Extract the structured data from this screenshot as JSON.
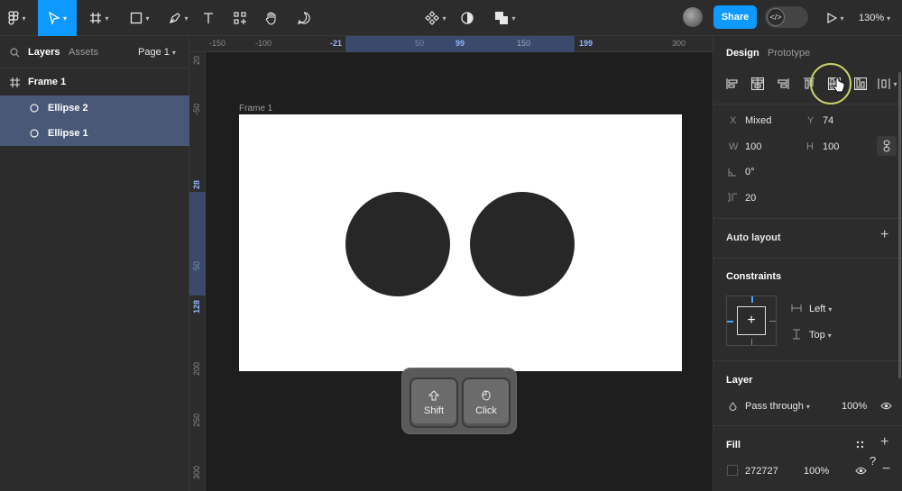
{
  "toolbar": {
    "share_label": "Share",
    "zoom_label": "130%",
    "devmode_icon": "</>",
    "accent_color": "#0d99ff"
  },
  "left_panel": {
    "tab_layers": "Layers",
    "tab_assets": "Assets",
    "page_label": "Page 1",
    "layers": [
      {
        "name": "Frame 1",
        "icon": "frame-icon"
      },
      {
        "name": "Ellipse 2",
        "icon": "ellipse-icon"
      },
      {
        "name": "Ellipse 1",
        "icon": "ellipse-icon"
      }
    ]
  },
  "ruler": {
    "top_ticks": [
      "-150",
      "-100",
      "-21",
      "50",
      "99",
      "150",
      "199",
      "300"
    ],
    "left_ticks": [
      "20",
      "-50",
      "28",
      "50",
      "128",
      "200",
      "250",
      "300"
    ]
  },
  "canvas": {
    "frame_label": "Frame 1",
    "frame_fill": "#ffffff",
    "ellipse_fill": "#272727",
    "keys": [
      {
        "label": "Shift",
        "icon": "shift-arrow-icon"
      },
      {
        "label": "Click",
        "icon": "mouse-icon"
      }
    ]
  },
  "right_panel": {
    "tab_design": "Design",
    "tab_prototype": "Prototype",
    "x_label": "X",
    "x_value": "Mixed",
    "y_label": "Y",
    "y_value": "74",
    "w_label": "W",
    "w_value": "100",
    "h_label": "H",
    "h_value": "100",
    "rotation_value": "0°",
    "corner_value": "20",
    "auto_layout_label": "Auto layout",
    "constraints_label": "Constraints",
    "constraint_h": "Left",
    "constraint_v": "Top",
    "layer_label": "Layer",
    "blend_mode": "Pass through",
    "layer_opacity": "100%",
    "fill_label": "Fill",
    "fill_hex": "272727",
    "fill_opacity": "100%",
    "help_label": "?"
  }
}
